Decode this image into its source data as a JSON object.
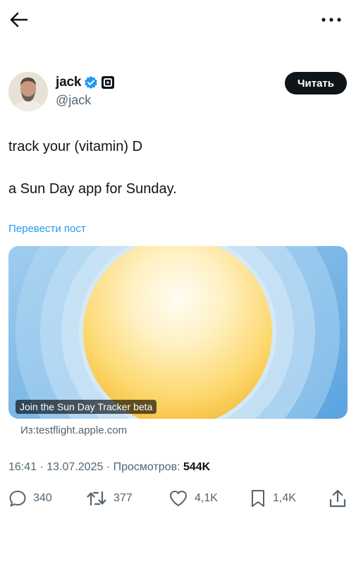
{
  "topbar": {
    "back_icon": "arrow-left-icon",
    "more_icon": "more-horizontal-icon"
  },
  "author": {
    "name": "jack",
    "handle": "@jack",
    "verified_icon": "verified-badge-icon",
    "affiliate_icon": "square-affiliate-icon",
    "follow_label": "Читать"
  },
  "tweet": {
    "line1": "track your (vitamin) D",
    "line2": "a Sun Day app for Sunday.",
    "translate_label": "Перевести пост"
  },
  "card": {
    "caption": "Join the Sun Day Tracker beta",
    "source": "Из:testflight.apple.com"
  },
  "meta": {
    "time": "16:41",
    "date": "13.07.2025",
    "views_label": "Просмотров:",
    "views_count": "544K",
    "separator": "·"
  },
  "actions": {
    "replies": "340",
    "reposts": "377",
    "likes": "4,1K",
    "bookmarks": "1,4K"
  },
  "colors": {
    "accent": "#1d9bf0",
    "text": "#0f1419",
    "muted": "#536471",
    "verified": "#1d9bf0"
  }
}
